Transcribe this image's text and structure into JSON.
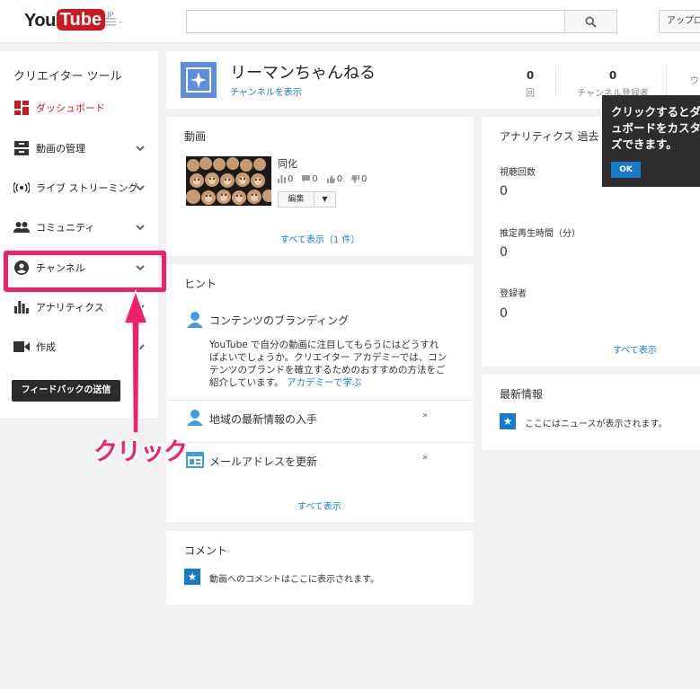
{
  "header": {
    "logo_you": "You",
    "logo_tube": "Tube",
    "logo_region": "JP",
    "search_placeholder": "",
    "upload_label": "アップロード"
  },
  "sidebar": {
    "title": "クリエイター ツール",
    "items": [
      {
        "label": "ダッシュボード",
        "icon": "dashboard-icon",
        "active": true
      },
      {
        "label": "動画の管理",
        "icon": "video-manager-icon",
        "expandable": true
      },
      {
        "label": "ライブ ストリーミング",
        "icon": "live-streaming-icon",
        "expandable": true
      },
      {
        "label": "コミュニティ",
        "icon": "community-icon",
        "expandable": true
      },
      {
        "label": "チャンネル",
        "icon": "channel-icon",
        "expandable": true
      },
      {
        "label": "アナリティクス",
        "icon": "analytics-icon",
        "expandable": true
      },
      {
        "label": "作成",
        "icon": "create-icon",
        "expandable": true
      }
    ],
    "feedback_label": "フィードバックの送信"
  },
  "annotation": {
    "click_label": "クリック",
    "color": "#f0206a"
  },
  "channel": {
    "name": "リーマンちゃんねる",
    "view_channel_link": "チャンネルを表示",
    "stats": [
      {
        "value": "0",
        "label": "回"
      },
      {
        "value": "0",
        "label": "チャンネル登録者"
      },
      {
        "value": "",
        "label": "ウ"
      }
    ]
  },
  "videos_card": {
    "title": "動画",
    "video": {
      "title": "同化",
      "views": "0",
      "comments": "0",
      "likes": "0",
      "dislikes": "0",
      "edit_label": "編集"
    },
    "see_all": "すべて表示（1 件）"
  },
  "hints_card": {
    "title": "ヒント",
    "items": [
      {
        "title": "コンテンツのブランディング",
        "body": "YouTube で自分の動画に注目してもらうにはどうすればよいでしょうか。クリエイター アカデミーでは、コンテンツのブランドを確立するためのおすすめの方法をご紹介しています。",
        "link": "アカデミーで学ぶ"
      },
      {
        "title": "地域の最新情報の入手"
      },
      {
        "title": "メールアドレスを更新"
      }
    ],
    "see_all": "すべて表示"
  },
  "comments_card": {
    "title": "コメント",
    "message": "動画へのコメントはここに表示されます。"
  },
  "analytics_card": {
    "title": "アナリティクス  過去",
    "metrics": [
      {
        "label": "視聴回数",
        "value": "0"
      },
      {
        "label": "推定再生時間（分）",
        "value": "0"
      },
      {
        "label": "登録者",
        "value": "0"
      }
    ],
    "see_all": "すべて表示"
  },
  "news_card": {
    "title": "最新情報",
    "message": "ここにはニュースが表示されます。"
  },
  "tooltip": {
    "text_line1": "クリックするとダ",
    "text_line2": "ュボードをカスタ",
    "text_line3": "ズできます。",
    "ok_label": "OK"
  },
  "colors": {
    "brand_red": "#cc181e",
    "link_blue": "#167ac6",
    "highlight_pink": "#f0206a"
  }
}
